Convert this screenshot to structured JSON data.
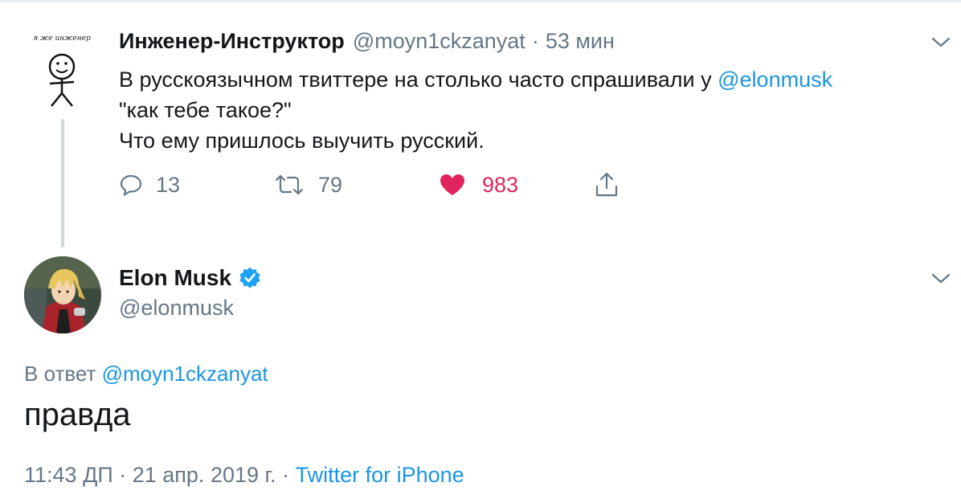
{
  "parent_tweet": {
    "avatar": {
      "caption": "я же инженер",
      "icon": "stick-figure-drawing"
    },
    "author_name": "Инженер-Инструктор",
    "author_handle": "@moyn1ckzanyat",
    "separator": "·",
    "time": "53 мин",
    "text_line1": "В русскоязычном твиттере на столько часто спрашивали у ",
    "text_mention": "@elonmusk",
    "text_line2": "\"как тебе такое?\"",
    "text_line3": "Что ему пришлось выучить русский.",
    "actions": {
      "replies": "13",
      "retweets": "79",
      "likes": "983"
    }
  },
  "main_tweet": {
    "author_name": "Elon Musk",
    "author_handle": "@elonmusk",
    "verified": true,
    "reply_to_prefix": "В ответ ",
    "reply_to_handle": "@moyn1ckzanyat",
    "text": "правда",
    "timestamp": "11:43 ДП · 21 апр. 2019 г. · ",
    "source": "Twitter for iPhone"
  },
  "colors": {
    "link": "#1b95e0",
    "muted": "#657786",
    "like": "#e0245e",
    "verified": "#1da1f2"
  }
}
